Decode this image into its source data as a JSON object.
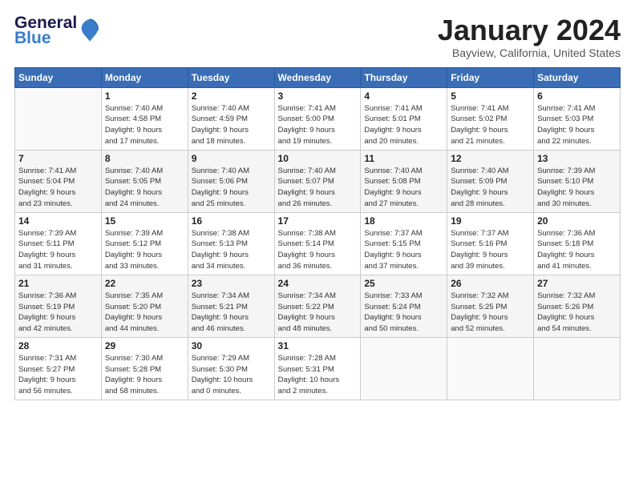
{
  "logo": {
    "line1": "General",
    "line2": "Blue"
  },
  "title": "January 2024",
  "subtitle": "Bayview, California, United States",
  "days_header": [
    "Sunday",
    "Monday",
    "Tuesday",
    "Wednesday",
    "Thursday",
    "Friday",
    "Saturday"
  ],
  "weeks": [
    [
      {
        "num": "",
        "info": ""
      },
      {
        "num": "1",
        "info": "Sunrise: 7:40 AM\nSunset: 4:58 PM\nDaylight: 9 hours\nand 17 minutes."
      },
      {
        "num": "2",
        "info": "Sunrise: 7:40 AM\nSunset: 4:59 PM\nDaylight: 9 hours\nand 18 minutes."
      },
      {
        "num": "3",
        "info": "Sunrise: 7:41 AM\nSunset: 5:00 PM\nDaylight: 9 hours\nand 19 minutes."
      },
      {
        "num": "4",
        "info": "Sunrise: 7:41 AM\nSunset: 5:01 PM\nDaylight: 9 hours\nand 20 minutes."
      },
      {
        "num": "5",
        "info": "Sunrise: 7:41 AM\nSunset: 5:02 PM\nDaylight: 9 hours\nand 21 minutes."
      },
      {
        "num": "6",
        "info": "Sunrise: 7:41 AM\nSunset: 5:03 PM\nDaylight: 9 hours\nand 22 minutes."
      }
    ],
    [
      {
        "num": "7",
        "info": "Sunrise: 7:41 AM\nSunset: 5:04 PM\nDaylight: 9 hours\nand 23 minutes."
      },
      {
        "num": "8",
        "info": "Sunrise: 7:40 AM\nSunset: 5:05 PM\nDaylight: 9 hours\nand 24 minutes."
      },
      {
        "num": "9",
        "info": "Sunrise: 7:40 AM\nSunset: 5:06 PM\nDaylight: 9 hours\nand 25 minutes."
      },
      {
        "num": "10",
        "info": "Sunrise: 7:40 AM\nSunset: 5:07 PM\nDaylight: 9 hours\nand 26 minutes."
      },
      {
        "num": "11",
        "info": "Sunrise: 7:40 AM\nSunset: 5:08 PM\nDaylight: 9 hours\nand 27 minutes."
      },
      {
        "num": "12",
        "info": "Sunrise: 7:40 AM\nSunset: 5:09 PM\nDaylight: 9 hours\nand 28 minutes."
      },
      {
        "num": "13",
        "info": "Sunrise: 7:39 AM\nSunset: 5:10 PM\nDaylight: 9 hours\nand 30 minutes."
      }
    ],
    [
      {
        "num": "14",
        "info": "Sunrise: 7:39 AM\nSunset: 5:11 PM\nDaylight: 9 hours\nand 31 minutes."
      },
      {
        "num": "15",
        "info": "Sunrise: 7:39 AM\nSunset: 5:12 PM\nDaylight: 9 hours\nand 33 minutes."
      },
      {
        "num": "16",
        "info": "Sunrise: 7:38 AM\nSunset: 5:13 PM\nDaylight: 9 hours\nand 34 minutes."
      },
      {
        "num": "17",
        "info": "Sunrise: 7:38 AM\nSunset: 5:14 PM\nDaylight: 9 hours\nand 36 minutes."
      },
      {
        "num": "18",
        "info": "Sunrise: 7:37 AM\nSunset: 5:15 PM\nDaylight: 9 hours\nand 37 minutes."
      },
      {
        "num": "19",
        "info": "Sunrise: 7:37 AM\nSunset: 5:16 PM\nDaylight: 9 hours\nand 39 minutes."
      },
      {
        "num": "20",
        "info": "Sunrise: 7:36 AM\nSunset: 5:18 PM\nDaylight: 9 hours\nand 41 minutes."
      }
    ],
    [
      {
        "num": "21",
        "info": "Sunrise: 7:36 AM\nSunset: 5:19 PM\nDaylight: 9 hours\nand 42 minutes."
      },
      {
        "num": "22",
        "info": "Sunrise: 7:35 AM\nSunset: 5:20 PM\nDaylight: 9 hours\nand 44 minutes."
      },
      {
        "num": "23",
        "info": "Sunrise: 7:34 AM\nSunset: 5:21 PM\nDaylight: 9 hours\nand 46 minutes."
      },
      {
        "num": "24",
        "info": "Sunrise: 7:34 AM\nSunset: 5:22 PM\nDaylight: 9 hours\nand 48 minutes."
      },
      {
        "num": "25",
        "info": "Sunrise: 7:33 AM\nSunset: 5:24 PM\nDaylight: 9 hours\nand 50 minutes."
      },
      {
        "num": "26",
        "info": "Sunrise: 7:32 AM\nSunset: 5:25 PM\nDaylight: 9 hours\nand 52 minutes."
      },
      {
        "num": "27",
        "info": "Sunrise: 7:32 AM\nSunset: 5:26 PM\nDaylight: 9 hours\nand 54 minutes."
      }
    ],
    [
      {
        "num": "28",
        "info": "Sunrise: 7:31 AM\nSunset: 5:27 PM\nDaylight: 9 hours\nand 56 minutes."
      },
      {
        "num": "29",
        "info": "Sunrise: 7:30 AM\nSunset: 5:28 PM\nDaylight: 9 hours\nand 58 minutes."
      },
      {
        "num": "30",
        "info": "Sunrise: 7:29 AM\nSunset: 5:30 PM\nDaylight: 10 hours\nand 0 minutes."
      },
      {
        "num": "31",
        "info": "Sunrise: 7:28 AM\nSunset: 5:31 PM\nDaylight: 10 hours\nand 2 minutes."
      },
      {
        "num": "",
        "info": ""
      },
      {
        "num": "",
        "info": ""
      },
      {
        "num": "",
        "info": ""
      }
    ]
  ]
}
